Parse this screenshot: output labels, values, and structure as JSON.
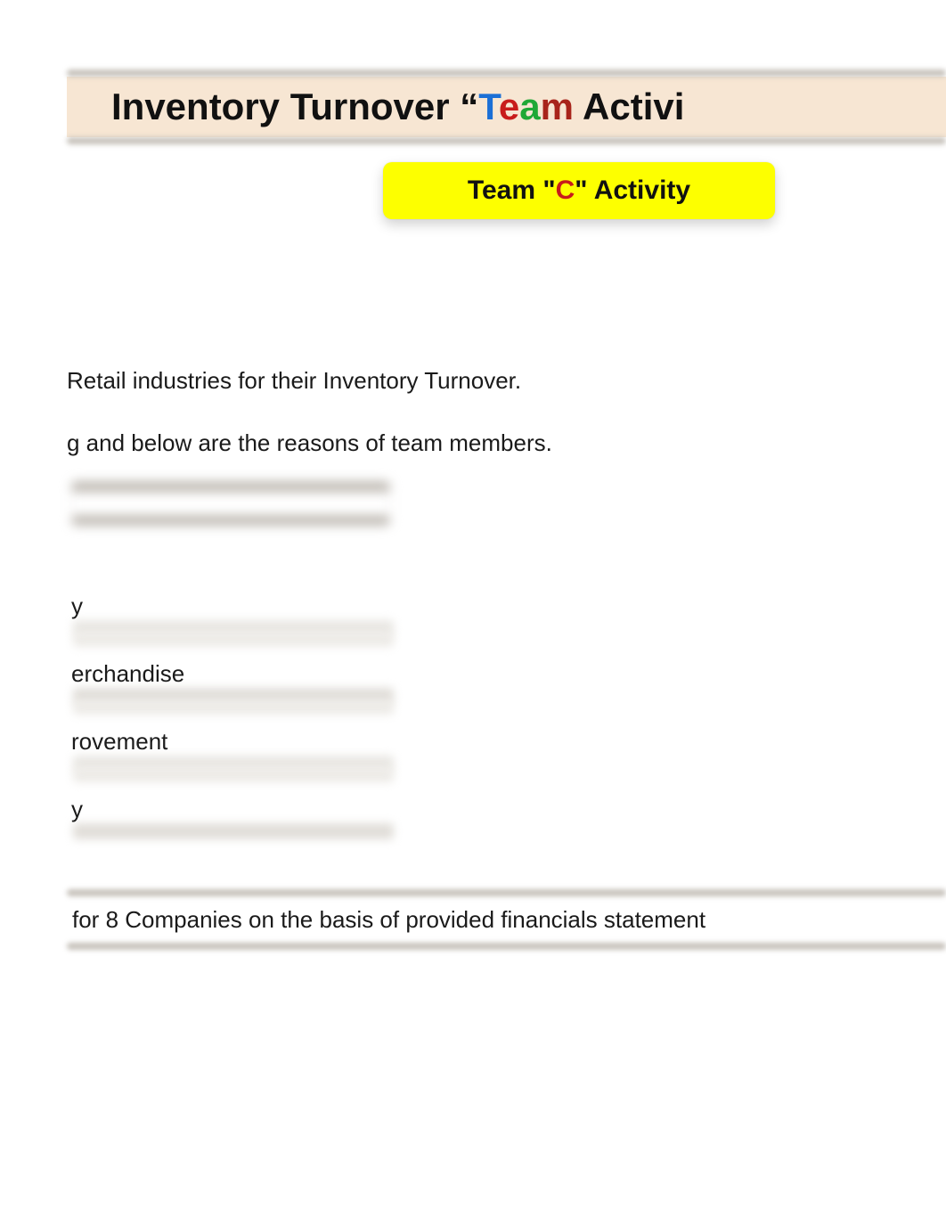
{
  "header": {
    "title_prefix": "Inventory Turnover “",
    "team_T": "T",
    "team_e": "e",
    "team_a": "a",
    "team_m": "m",
    "title_suffix": " Activi"
  },
  "badge": {
    "prefix": "Team \"",
    "letter": "C",
    "suffix": "\" Activity"
  },
  "body": {
    "line1": "Retail industries for their Inventory Turnover.",
    "line2": "g and below are the reasons of team members."
  },
  "list": {
    "row1": "y",
    "row2": "erchandise",
    "row3": "rovement",
    "row4": "y"
  },
  "section": {
    "text": "for 8 Companies on the basis of provided financials statement"
  }
}
